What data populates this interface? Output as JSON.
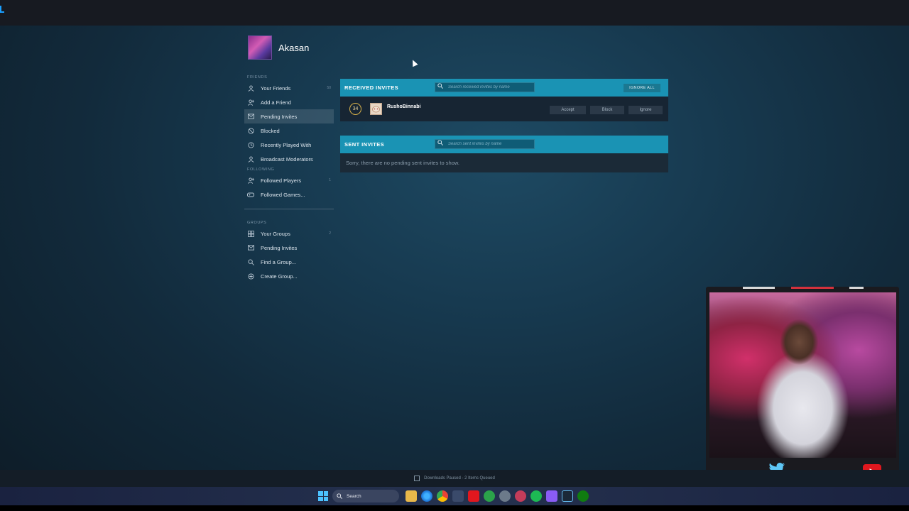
{
  "profile": {
    "name": "Akasan"
  },
  "sidebar": {
    "friends_header": "FRIENDS",
    "friends_items": [
      {
        "label": "Your Friends",
        "icon": "person-icon",
        "count": "50"
      },
      {
        "label": "Add a Friend",
        "icon": "add-person-icon",
        "count": ""
      },
      {
        "label": "Pending Invites",
        "icon": "envelope-icon",
        "count": "",
        "active": true
      },
      {
        "label": "Blocked",
        "icon": "blocked-icon",
        "count": ""
      },
      {
        "label": "Recently Played With",
        "icon": "clock-icon",
        "count": ""
      },
      {
        "label": "Broadcast Moderators",
        "icon": "person-icon",
        "count": ""
      }
    ],
    "following_header": "FOLLOWING",
    "following_items": [
      {
        "label": "Followed Players",
        "icon": "add-person-icon",
        "count": "1"
      },
      {
        "label": "Followed Games...",
        "icon": "gamepad-icon",
        "count": ""
      }
    ],
    "groups_header": "GROUPS",
    "groups_items": [
      {
        "label": "Your Groups",
        "icon": "groups-icon",
        "count": "2"
      },
      {
        "label": "Pending Invites",
        "icon": "envelope-icon",
        "count": ""
      },
      {
        "label": "Find a Group...",
        "icon": "search-icon",
        "count": ""
      },
      {
        "label": "Create Group...",
        "icon": "plus-circle-icon",
        "count": ""
      }
    ]
  },
  "received": {
    "title": "RECEIVED INVITES",
    "search_placeholder": "Search received invites by name",
    "ignore_all": "IGNORE ALL",
    "invite": {
      "level": "34",
      "name": "RushoBinnabi",
      "accept": "Accept",
      "block": "Block",
      "ignore": "Ignore"
    }
  },
  "sent": {
    "title": "SENT INVITES",
    "search_placeholder": "Search sent invites by name",
    "empty_message": "Sorry, there are no pending sent invites to show."
  },
  "status_bar": {
    "text": "Downloads Paused - 2 Items Queued"
  },
  "taskbar": {
    "search_label": "Search"
  },
  "colors": {
    "accent": "#1a93b4",
    "background": "#122a3b",
    "level_ring": "#d9b24a"
  }
}
